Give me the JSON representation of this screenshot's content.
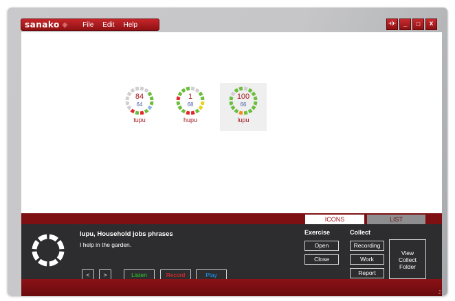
{
  "app": {
    "logo_text": "sanako",
    "logo_wave": "-ı|ı-",
    "menu": [
      "File",
      "Edit",
      "Help"
    ],
    "window_buttons": {
      "audio": "-ı|ı-",
      "minimize": "_",
      "maximize": "□",
      "close": "x"
    }
  },
  "results": [
    {
      "score": "84",
      "sub": "64",
      "label": "tupu",
      "selected": false
    },
    {
      "score": "1",
      "sub": "68",
      "label": "hupu",
      "selected": false
    },
    {
      "score": "100",
      "sub": "66",
      "label": "lupu",
      "selected": true
    }
  ],
  "tabs": {
    "icons": "ICONS",
    "list": "LIST"
  },
  "exercise": {
    "title": "lupu, Household jobs phrases",
    "sentence": "I help in the garden."
  },
  "player": {
    "prev": "<",
    "next": ">",
    "listen": "Listen",
    "record": "Record",
    "play": "Play"
  },
  "exercise_section": {
    "heading": "Exercise",
    "open": "Open",
    "close": "Close"
  },
  "collect_section": {
    "heading": "Collect",
    "recording": "Recording",
    "work": "Work",
    "report": "Report",
    "view_collect_folder_line1": "View",
    "view_collect_folder_line2": "Collect",
    "view_collect_folder_line3": "Folder"
  },
  "colors": {
    "brand_red": "#a3141a",
    "listen": "#2fd32f",
    "record": "#ff2a2a",
    "play": "#1e9bff",
    "seg_green": "#6bbd3c",
    "seg_yellow": "#e8d21e",
    "seg_red": "#e0262b",
    "seg_gray": "#cfcfcf",
    "seg_blue": "#8fb7e0",
    "seg_orange": "#f08a1e"
  },
  "ring_segments": [
    [
      "seg_gray",
      "seg_gray",
      "seg_green",
      "seg_green",
      "seg_green",
      "seg_blue",
      "seg_green",
      "seg_red",
      "seg_green",
      "seg_red",
      "seg_gray",
      "seg_gray",
      "seg_gray",
      "seg_gray",
      "seg_gray",
      "seg_gray"
    ],
    [
      "seg_gray",
      "seg_gray",
      "seg_green",
      "seg_green",
      "seg_yellow",
      "seg_yellow",
      "seg_green",
      "seg_red",
      "seg_red",
      "seg_green",
      "seg_green",
      "seg_green",
      "seg_red",
      "seg_green",
      "seg_green",
      "seg_green"
    ],
    [
      "seg_gray",
      "seg_green",
      "seg_green",
      "seg_green",
      "seg_green",
      "seg_green",
      "seg_green",
      "seg_green",
      "seg_orange",
      "seg_green",
      "seg_green",
      "seg_green",
      "seg_green",
      "seg_gray",
      "seg_green",
      "seg_green"
    ]
  ]
}
